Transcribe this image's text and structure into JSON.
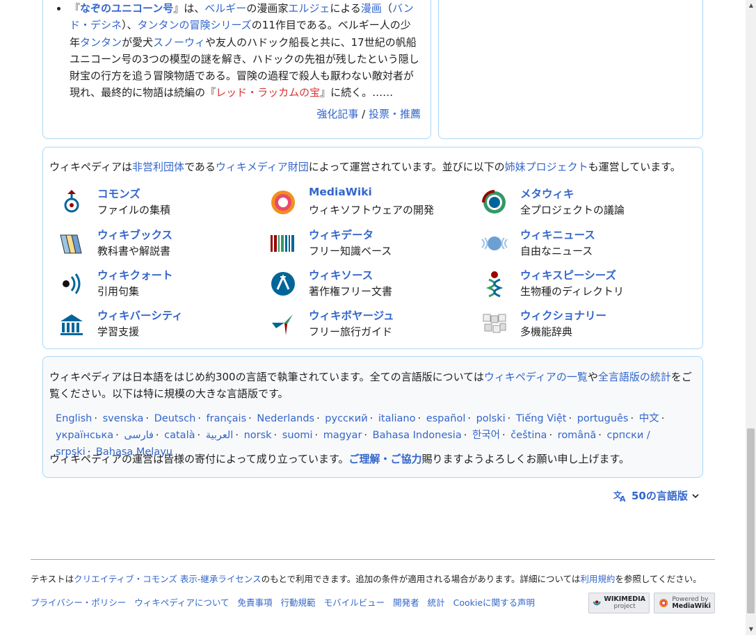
{
  "featured": {
    "segments": [
      {
        "t": "『",
        "c": "txt"
      },
      {
        "t": "なぞのユニコーン号",
        "c": "linkbold"
      },
      {
        "t": "』は、",
        "c": "txt"
      },
      {
        "t": "ベルギー",
        "c": "link"
      },
      {
        "t": "の漫画家",
        "c": "txt"
      },
      {
        "t": "エルジェ",
        "c": "link"
      },
      {
        "t": "による",
        "c": "txt"
      },
      {
        "t": "漫画",
        "c": "link"
      },
      {
        "t": "（",
        "c": "txt"
      },
      {
        "t": "バンド・デシネ",
        "c": "link"
      },
      {
        "t": "）、",
        "c": "txt"
      },
      {
        "t": "タンタンの冒険シリーズ",
        "c": "link"
      },
      {
        "t": "の11作目である。ベルギー人の少年",
        "c": "txt"
      },
      {
        "t": "タンタン",
        "c": "link"
      },
      {
        "t": "が愛犬",
        "c": "txt"
      },
      {
        "t": "スノーウィ",
        "c": "link"
      },
      {
        "t": "や友人のハドック船長と共に、17世紀の帆船ユニコーン号の3つの模型の謎を解き、ハドックの先祖が残したという隠し財宝の行方を追う冒険物語である。冒険の過程で殺人も厭わない敵対者が現れ、最終的に物語は続編の『",
        "c": "txt"
      },
      {
        "t": "レッド・ラッカムの宝",
        "c": "red"
      },
      {
        "t": "』に続く。……",
        "c": "txt"
      }
    ],
    "links": {
      "more": "強化記事",
      "slash": " / ",
      "vote": "投票・推薦"
    }
  },
  "sister": {
    "intro": [
      {
        "t": "ウィキペディアは",
        "c": "txt"
      },
      {
        "t": "非営利団体",
        "c": "link"
      },
      {
        "t": "である",
        "c": "txt"
      },
      {
        "t": "ウィキメディア財団",
        "c": "link"
      },
      {
        "t": "によって運営されています。並びに以下の",
        "c": "txt"
      },
      {
        "t": "姉妹プロジェクト",
        "c": "link"
      },
      {
        "t": "も運営しています。",
        "c": "txt"
      }
    ],
    "projects": [
      {
        "name": "コモンズ",
        "desc": "ファイルの集積",
        "icon": "commons-icon"
      },
      {
        "name": "MediaWiki",
        "desc": "ウィキソフトウェアの開発",
        "icon": "mediawiki-icon"
      },
      {
        "name": "メタウィキ",
        "desc": "全プロジェクトの議論",
        "icon": "metawiki-icon"
      },
      {
        "name": "ウィキブックス",
        "desc": "教科書や解説書",
        "icon": "wikibooks-icon"
      },
      {
        "name": "ウィキデータ",
        "desc": "フリー知識ベース",
        "icon": "wikidata-icon"
      },
      {
        "name": "ウィキニュース",
        "desc": "自由なニュース",
        "icon": "wikinews-icon"
      },
      {
        "name": "ウィキクォート",
        "desc": "引用句集",
        "icon": "wikiquote-icon"
      },
      {
        "name": "ウィキソース",
        "desc": "著作権フリー文書",
        "icon": "wikisource-icon"
      },
      {
        "name": "ウィキスピーシーズ",
        "desc": "生物種のディレクトリ",
        "icon": "wikispecies-icon"
      },
      {
        "name": "ウィキバーシティ",
        "desc": "学習支援",
        "icon": "wikiversity-icon"
      },
      {
        "name": "ウィキボヤージュ",
        "desc": "フリー旅行ガイド",
        "icon": "wikivoyage-icon"
      },
      {
        "name": "ウィクショナリー",
        "desc": "多機能辞典",
        "icon": "wiktionary-icon"
      }
    ]
  },
  "languages": {
    "intro": [
      {
        "t": "ウィキペディアは日本語をはじめ約300の言語で執筆されています。全ての言語版については",
        "c": "txt"
      },
      {
        "t": "ウィキペディアの一覧",
        "c": "link"
      },
      {
        "t": "や",
        "c": "txt"
      },
      {
        "t": "全言語版の統計",
        "c": "link"
      },
      {
        "t": "をご覧ください。以下は特に規模の大きな言語版です。",
        "c": "txt"
      }
    ],
    "list": [
      "English",
      "svenska",
      "Deutsch",
      "français",
      "Nederlands",
      "русский",
      "italiano",
      "español",
      "polski",
      "Tiếng Việt",
      "português",
      "中文",
      "українська",
      "فارسی",
      "català",
      "العربية",
      "norsk",
      "suomi",
      "magyar",
      "Bahasa Indonesia",
      "한국어",
      "čeština",
      "română",
      "српски / srpski",
      "Bahasa Melayu"
    ],
    "separator": "·",
    "footer": [
      {
        "t": "ウィキペディアの運営は皆様の寄付によって成り立っています。",
        "c": "txt"
      },
      {
        "t": "ご理解・ご協力",
        "c": "linkbold"
      },
      {
        "t": "賜りますようよろしくお願い申し上げます。",
        "c": "txt"
      }
    ]
  },
  "language_button": {
    "label": "50の言語版",
    "icon": "translate-icon"
  },
  "footer": {
    "license": [
      {
        "t": "テキストは",
        "c": "txt"
      },
      {
        "t": "クリエイティブ・コモンズ 表示-継承ライセンス",
        "c": "link"
      },
      {
        "t": "のもとで利用できます。追加の条件が適用される場合があります。詳細については",
        "c": "txt"
      },
      {
        "t": "利用規約",
        "c": "link"
      },
      {
        "t": "を参照してください。",
        "c": "txt"
      }
    ],
    "places": [
      "プライバシー・ポリシー",
      "ウィキペディアについて",
      "免責事項",
      "行動規範",
      "モバイルビュー",
      "開発者",
      "統計",
      "Cookieに関する声明"
    ],
    "badges": {
      "wikimedia_top": "WIKIMEDIA",
      "wikimedia_bottom": "project",
      "mediawiki_top": "Powered by",
      "mediawiki_bottom": "MediaWiki"
    }
  },
  "colors": {
    "link": "#3366cc",
    "red_link": "#d73333",
    "border": "#a7d7f9"
  }
}
